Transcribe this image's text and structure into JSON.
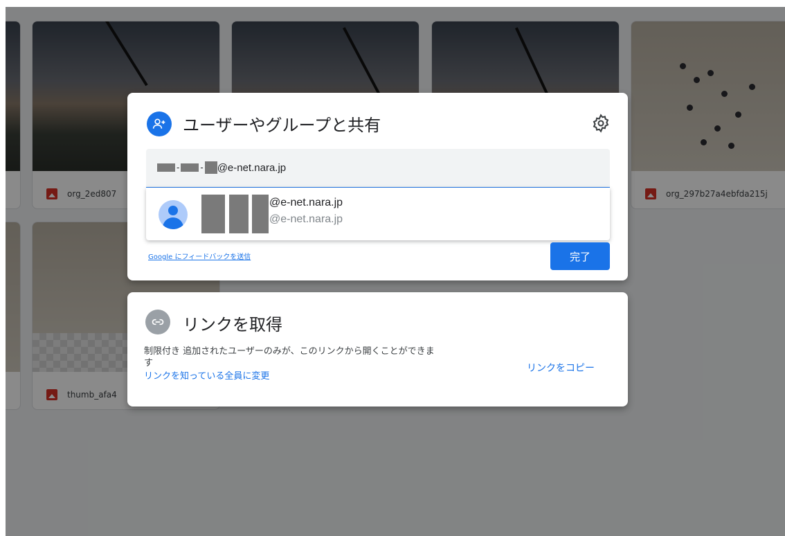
{
  "files": [
    {
      "name": "org_2ed807"
    },
    {
      "name": "org_297b27a4ebfda215j"
    },
    {
      "name": "thumb_afa4"
    }
  ],
  "share_dialog": {
    "title": "ユーザーやグループと共有",
    "icon": "person-add-icon",
    "settings_icon": "gear-icon",
    "input_value": "@e-net.nara.jp",
    "suggestion": {
      "name": "@e-net.nara.jp",
      "email": "@e-net.nara.jp"
    },
    "feedback_link": "Google にフィードバックを送信",
    "done_button": "完了"
  },
  "link_dialog": {
    "title": "リンクを取得",
    "icon": "link-icon",
    "description_line1": "制限付き 追加されたユーザーのみが、このリンクから開くことができま",
    "description_line2": "す",
    "change_link": "リンクを知っている全員に変更",
    "copy_link": "リンクをコピー"
  },
  "colors": {
    "accent": "#1a73e8",
    "overlay": "rgba(0,0,0,0.46)",
    "file_icon": "#d93025"
  }
}
